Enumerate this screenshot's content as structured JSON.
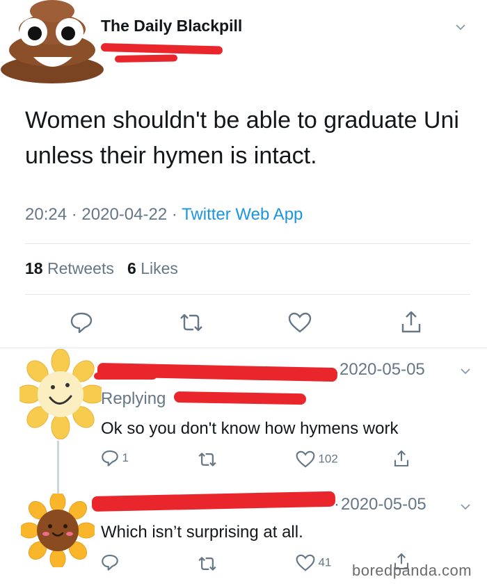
{
  "main_tweet": {
    "author_name": "The Daily Blackpill",
    "text": "Women shouldn't be able to graduate Uni unless their hymen is intact.",
    "time": "20:24",
    "date": "2020-04-22",
    "source": "Twitter Web App",
    "retweets_count": "18",
    "retweets_label": "Retweets",
    "likes_count": "6",
    "likes_label": "Likes",
    "avatar_icon": "poop-emoji-icon"
  },
  "replies": [
    {
      "date": "2020-05-05",
      "replying_label": "Replying",
      "text": "Ok so you don't know how hymens work",
      "reply_count": "1",
      "like_count": "102",
      "avatar_icon": "smiling-sun-icon"
    },
    {
      "date": "2020-05-05",
      "text": "Which isn’t surprising at all.",
      "reply_count": "",
      "like_count": "41",
      "avatar_icon": "sunflower-icon"
    }
  ],
  "watermark": "boredpanda.com",
  "colors": {
    "link": "#1b95e0",
    "muted": "#657786",
    "redaction": "#e8262c",
    "separator": "#e1e8ed"
  }
}
